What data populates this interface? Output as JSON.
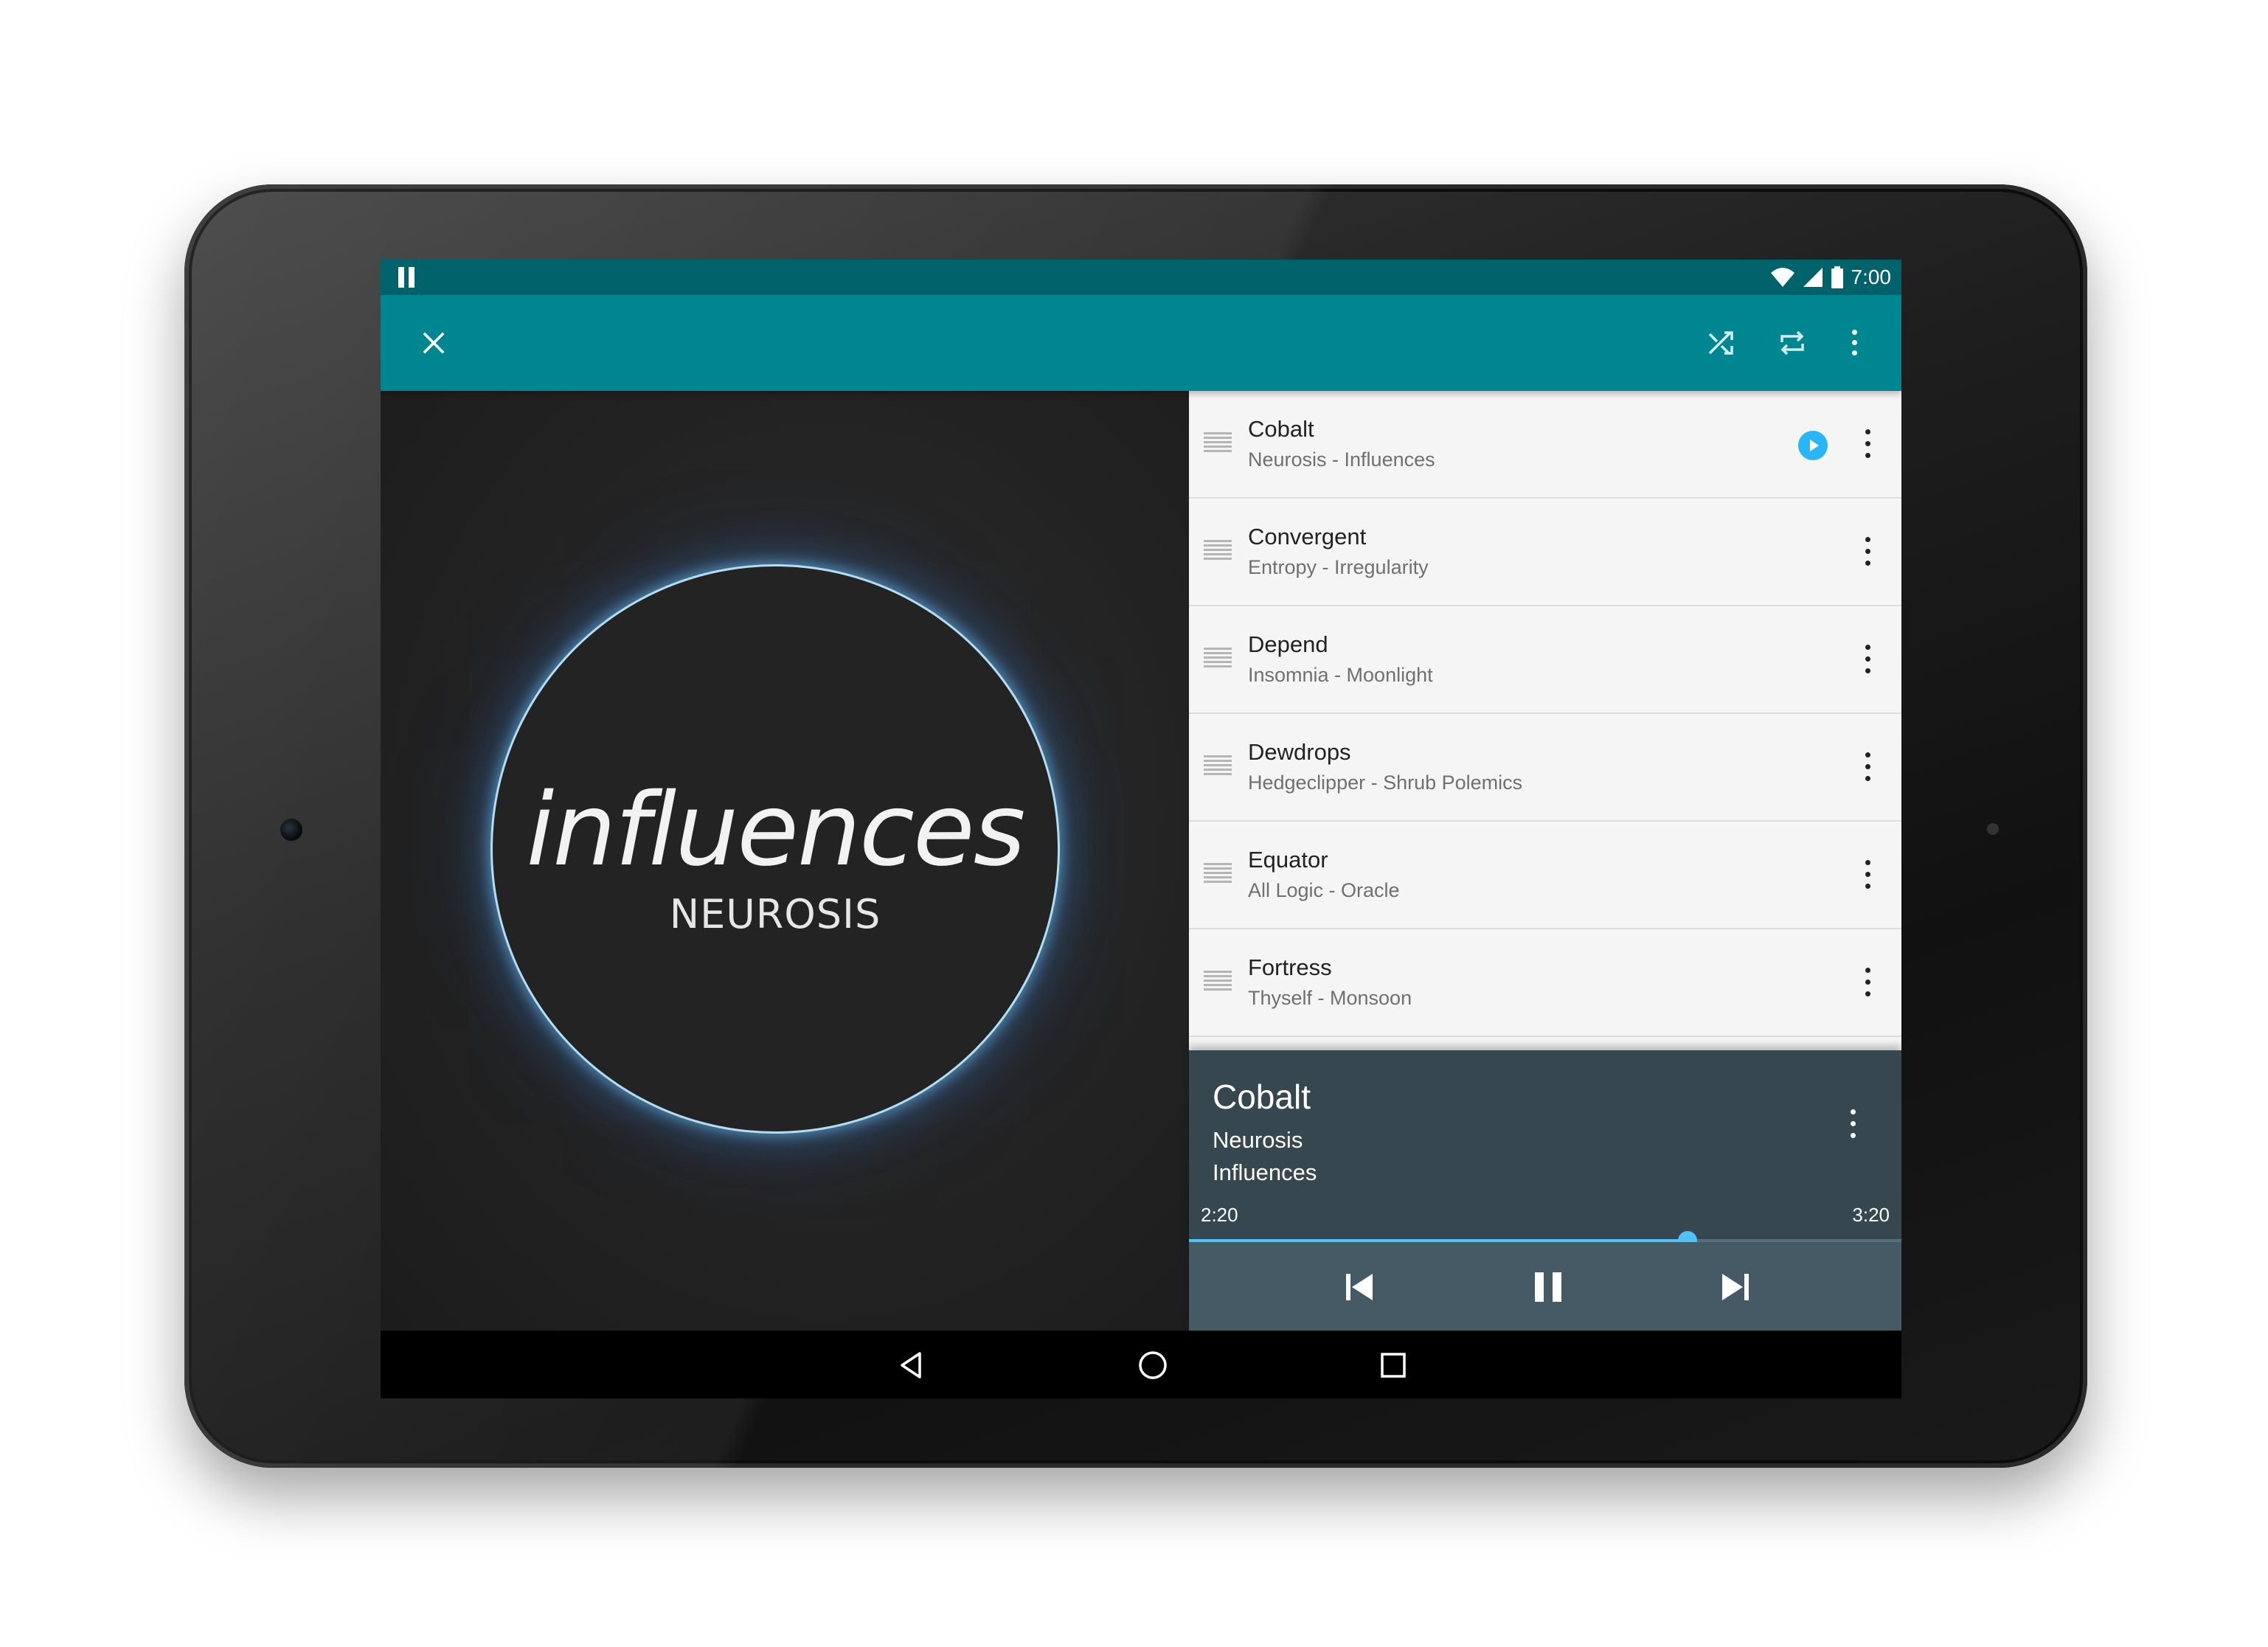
{
  "status_bar": {
    "time": "7:00",
    "icons": [
      "pause-icon",
      "wifi-icon",
      "signal-icon",
      "battery-icon"
    ]
  },
  "toolbar": {
    "close_icon": "close-icon",
    "actions": [
      "shuffle-icon",
      "repeat-icon",
      "more-vert-icon"
    ]
  },
  "album_art": {
    "title": "influences",
    "artist": "NEUROSIS"
  },
  "queue": {
    "items": [
      {
        "title": "Cobalt",
        "subtitle": "Neurosis - Influences",
        "playing": true
      },
      {
        "title": "Convergent",
        "subtitle": "Entropy - Irregularity",
        "playing": false
      },
      {
        "title": "Depend",
        "subtitle": "Insomnia - Moonlight",
        "playing": false
      },
      {
        "title": "Dewdrops",
        "subtitle": "Hedgeclipper - Shrub Polemics",
        "playing": false
      },
      {
        "title": "Equator",
        "subtitle": "All Logic - Oracle",
        "playing": false
      },
      {
        "title": "Fortress",
        "subtitle": "Thyself - Monsoon",
        "playing": false
      }
    ]
  },
  "now_playing": {
    "title": "Cobalt",
    "artist": "Neurosis",
    "album": "Influences",
    "elapsed": "2:20",
    "total": "3:20",
    "progress": 0.7
  },
  "controls": [
    "skip-previous-icon",
    "pause-icon",
    "skip-next-icon"
  ],
  "nav_bar": [
    "back-icon",
    "home-icon",
    "recents-icon"
  ],
  "colors": {
    "status_bar": "#00626b",
    "toolbar": "#008691",
    "accent": "#4fc3f7",
    "now_playing_bg": "#37474f",
    "controls_bg": "#455a64"
  }
}
